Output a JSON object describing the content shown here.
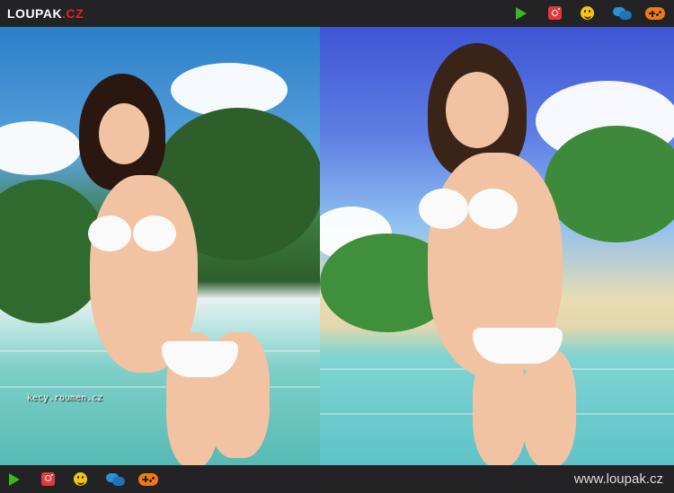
{
  "header": {
    "logo_name": "LOUPAK",
    "logo_tld": ".CZ"
  },
  "icons": [
    "play-icon",
    "instagram-icon",
    "smiley-icon",
    "chat-icon",
    "gamepad-icon"
  ],
  "image": {
    "watermark": "kecy.roumen.cz"
  },
  "footer": {
    "site_url": "www.loupak.cz"
  },
  "colors": {
    "bar_bg": "#232325",
    "logo_accent": "#e8202a",
    "play": "#3ab81d",
    "instagram": "#e23a3a",
    "smiley": "#f3c614",
    "chat": "#2c8fd8",
    "gamepad": "#f07a12"
  }
}
